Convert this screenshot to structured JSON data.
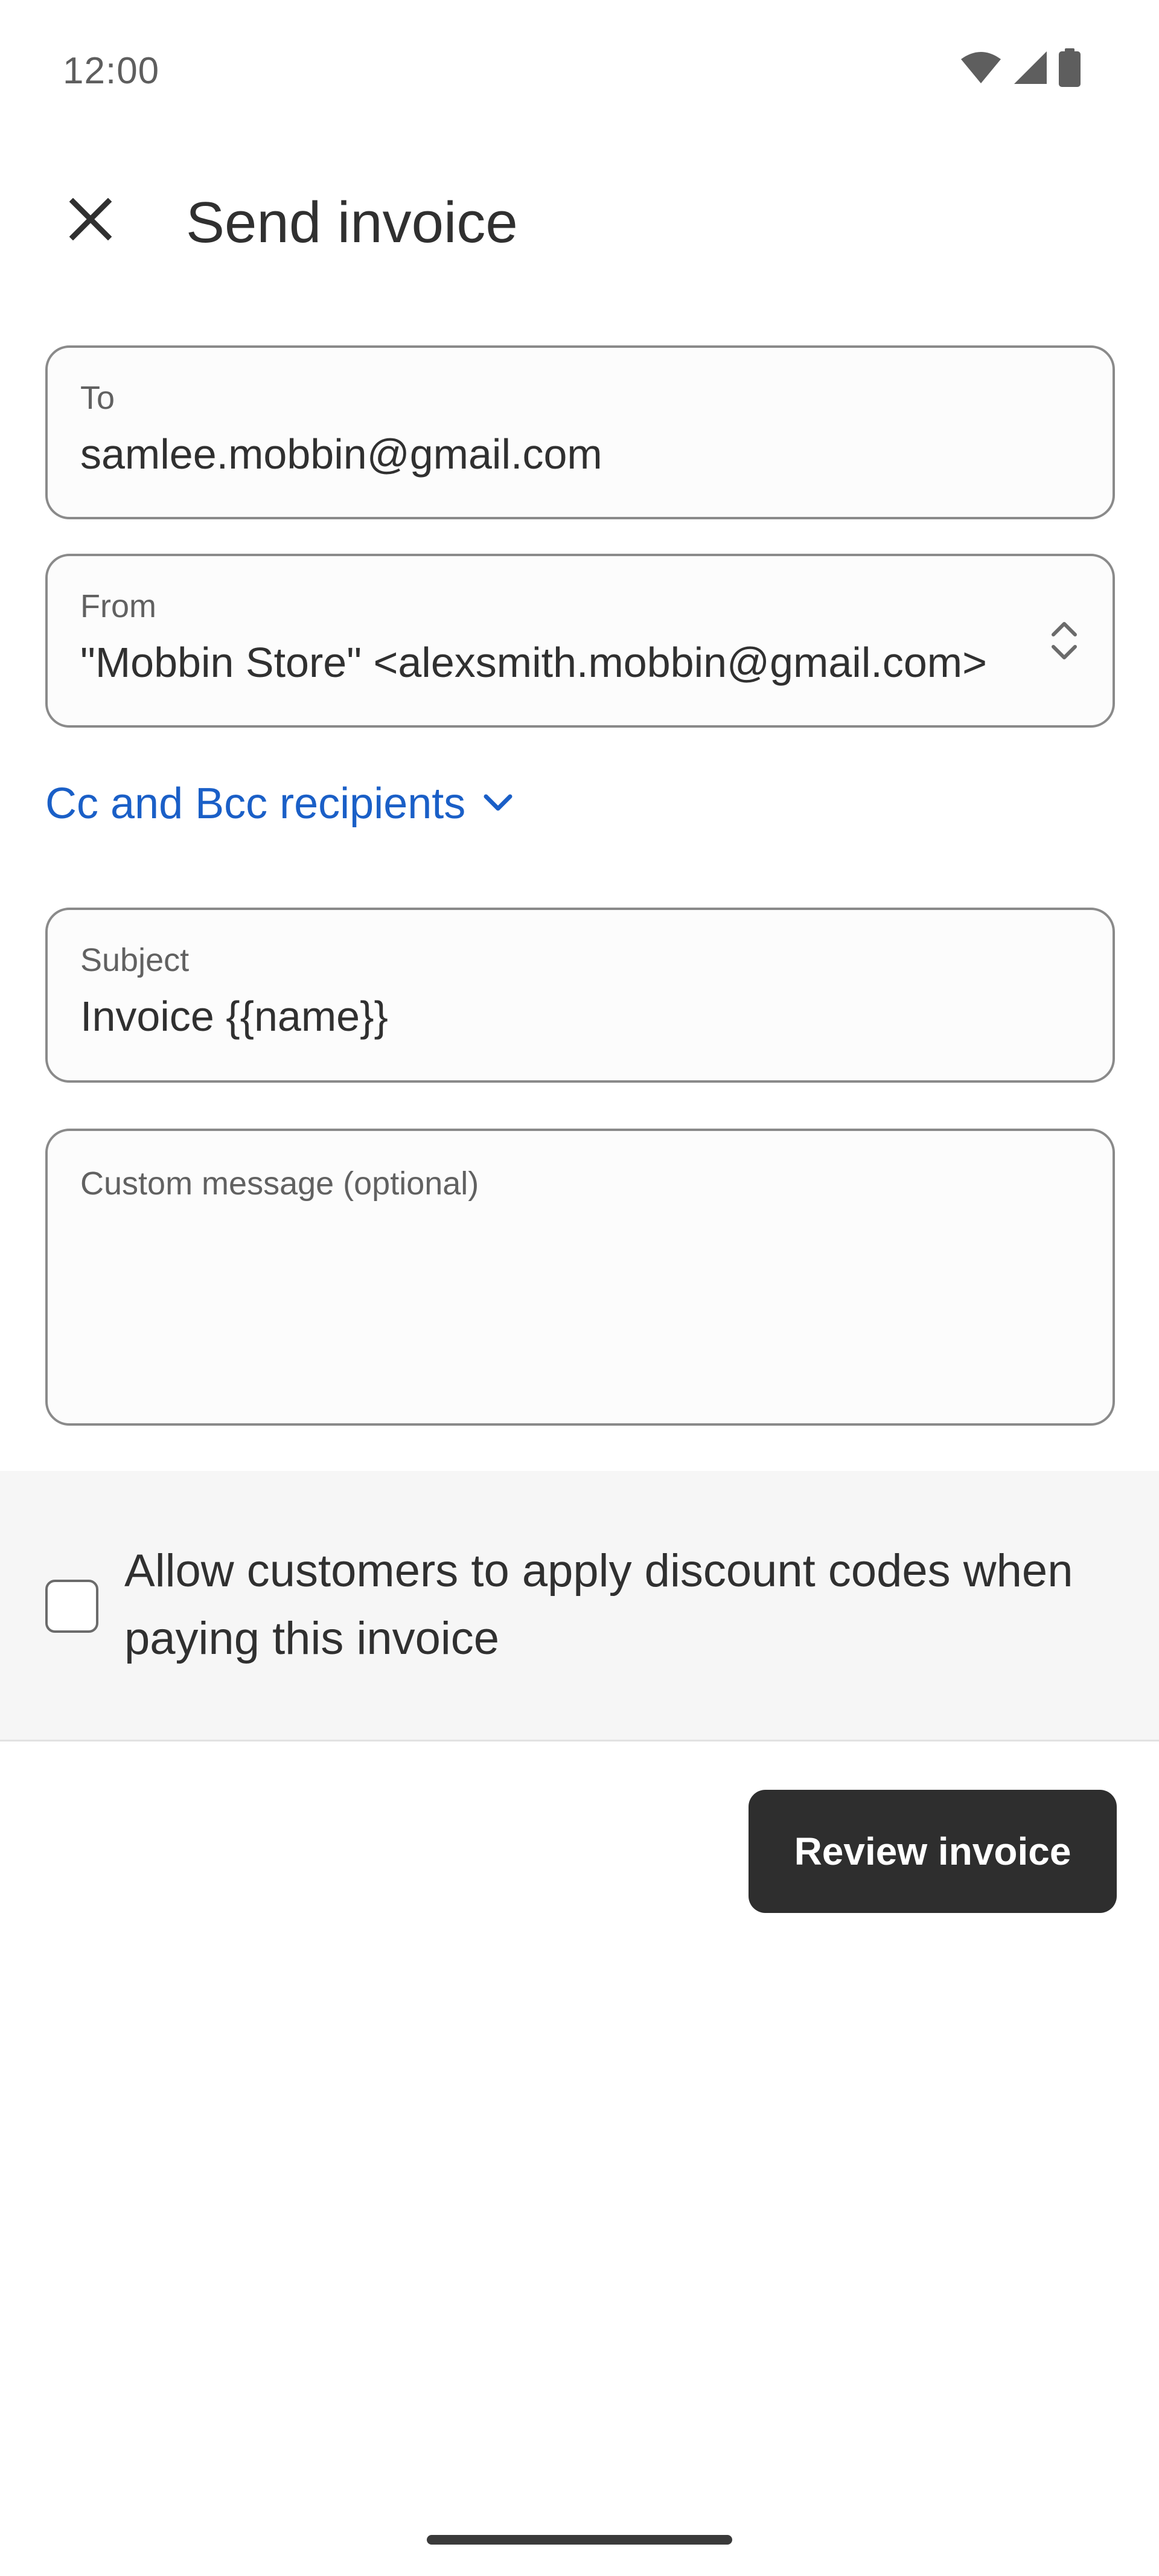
{
  "status_bar": {
    "time": "12:00",
    "icons": [
      "wifi-icon",
      "signal-icon",
      "battery-icon"
    ]
  },
  "header": {
    "close_icon": "close-icon",
    "title": "Send invoice"
  },
  "form": {
    "to": {
      "label": "To",
      "value": "samlee.mobbin@gmail.com"
    },
    "from": {
      "label": "From",
      "value": "\"Mobbin Store\" <alexsmith.mobbin@gmail.com>",
      "icon": "unfold-icon"
    },
    "cc_bcc": {
      "label": "Cc and Bcc recipients",
      "icon": "chevron-down-icon"
    },
    "subject": {
      "label": "Subject",
      "value": "Invoice {{name}}"
    },
    "message": {
      "placeholder": "Custom message (optional)",
      "value": ""
    }
  },
  "discount": {
    "checked": false,
    "label": "Allow customers to apply discount codes when paying this invoice"
  },
  "actions": {
    "review_label": "Review invoice"
  },
  "colors": {
    "link": "#1a5fc7",
    "primary_button": "#2e2e2e",
    "section_bg": "#f6f6f6"
  }
}
